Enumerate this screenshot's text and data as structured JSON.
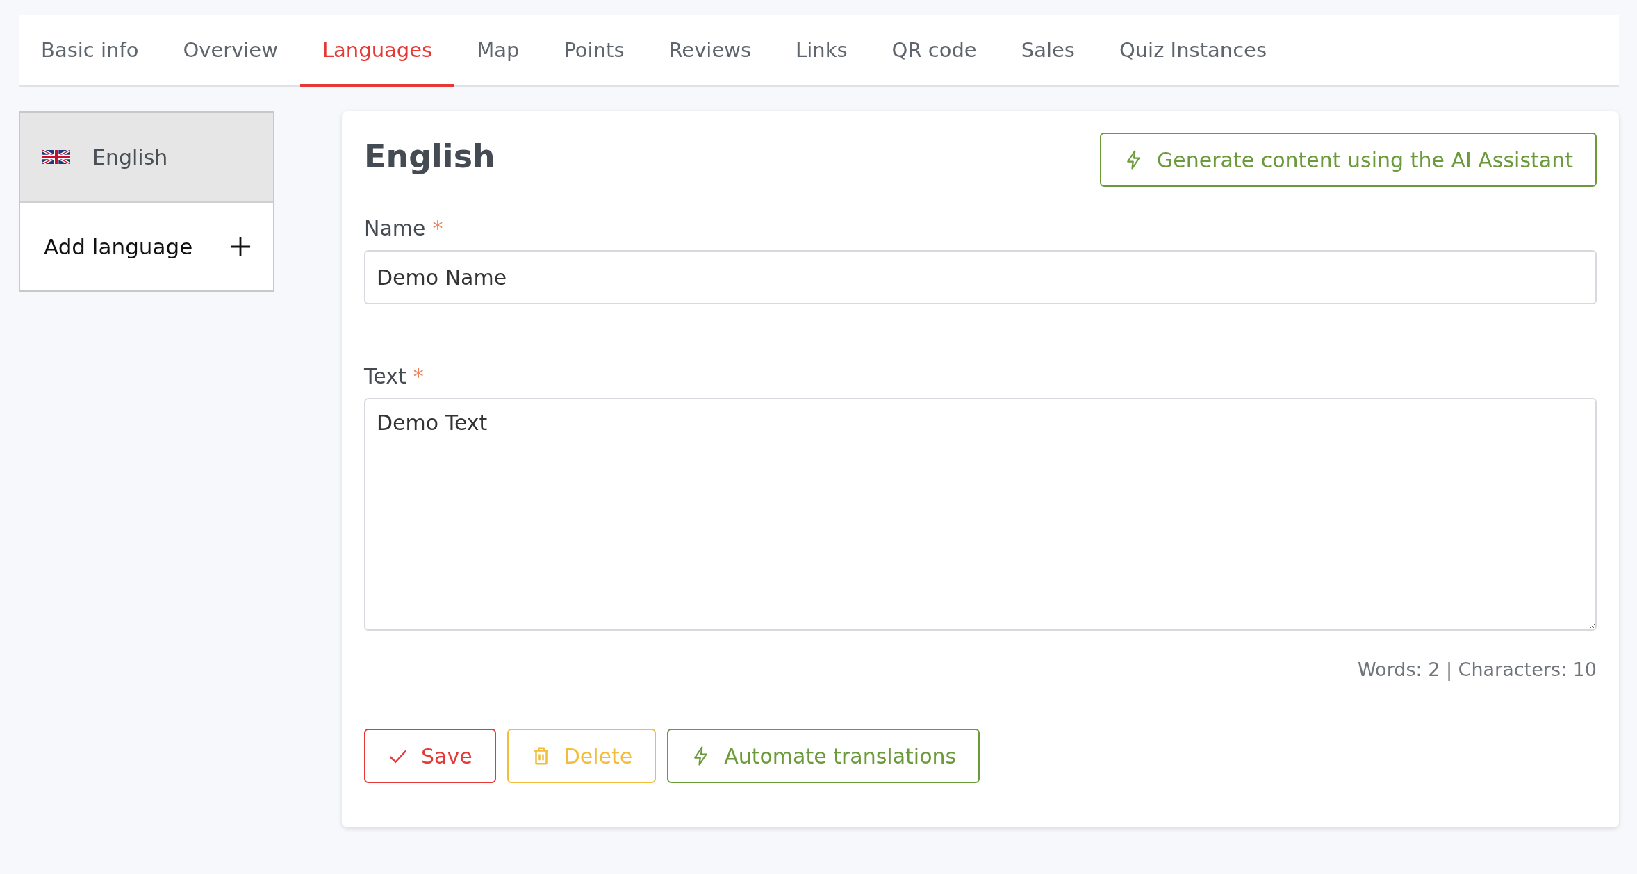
{
  "tabs": [
    {
      "label": "Basic info",
      "selected": false
    },
    {
      "label": "Overview",
      "selected": false
    },
    {
      "label": "Languages",
      "selected": true
    },
    {
      "label": "Map",
      "selected": false
    },
    {
      "label": "Points",
      "selected": false
    },
    {
      "label": "Reviews",
      "selected": false
    },
    {
      "label": "Links",
      "selected": false
    },
    {
      "label": "QR code",
      "selected": false
    },
    {
      "label": "Sales",
      "selected": false
    },
    {
      "label": "Quiz Instances",
      "selected": false
    }
  ],
  "languages": {
    "items": [
      {
        "label": "English",
        "selected": true
      }
    ],
    "add_label": "Add language"
  },
  "editor": {
    "title": "English",
    "ai_button": "Generate content using the AI Assistant",
    "fields": [
      {
        "kind": "input",
        "label": "Name",
        "required_mark": "*",
        "value": "Demo Name"
      },
      {
        "kind": "textarea",
        "label": "Text",
        "required_mark": "*",
        "value": "Demo Text"
      }
    ],
    "counter": "Words: 2 | Characters: 10",
    "buttons": [
      {
        "kind": "save",
        "label": "Save"
      },
      {
        "kind": "delete",
        "label": "Delete"
      },
      {
        "kind": "automate",
        "label": "Automate translations"
      }
    ]
  }
}
